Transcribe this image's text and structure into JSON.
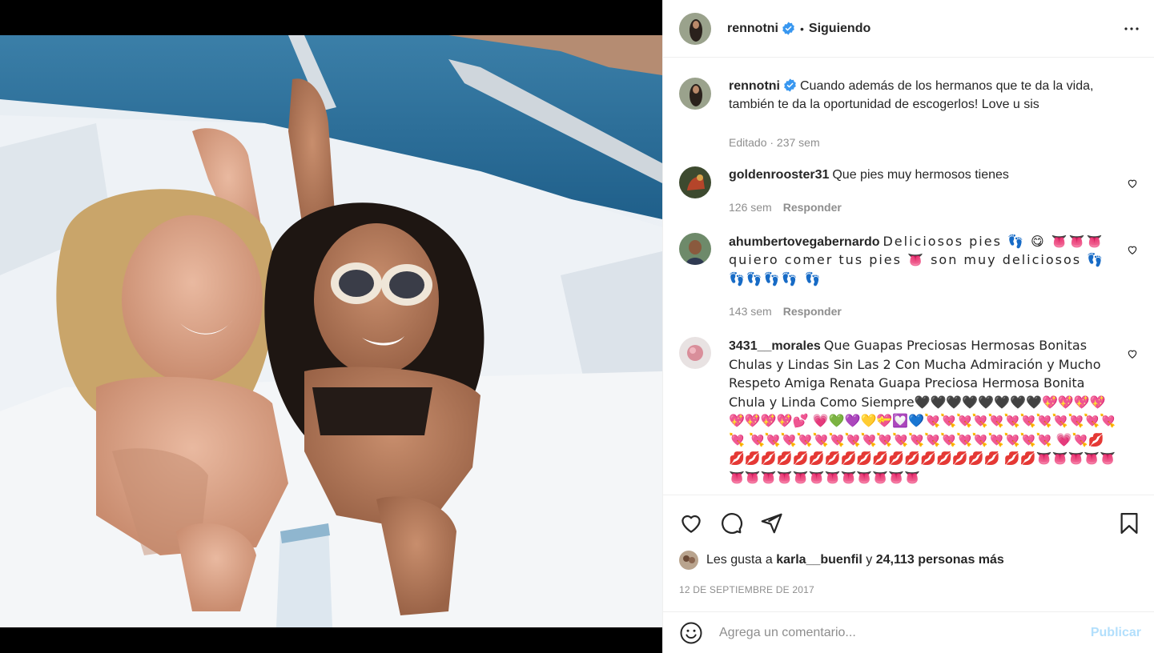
{
  "header": {
    "username": "rennotni",
    "separator": "•",
    "follow_status": "Siguiendo"
  },
  "caption": {
    "username": "rennotni",
    "text": "Cuando además de los hermanos que te da la vida, también te da la oportunidad de escogerlos! Love u sis",
    "meta": "Editado · 237 sem"
  },
  "comments": [
    {
      "username": "goldenrooster31",
      "text": "Que pies muy hermosos tienes",
      "time": "126 sem",
      "reply": "Responder"
    },
    {
      "username": "ahumbertovegabernardo",
      "text": "Deliciosos pies 👣 😋 👅👅👅 quiero comer tus pies 👅 son muy deliciosos 👣👣👣👣👣 👣",
      "time": "143 sem",
      "reply": "Responder"
    },
    {
      "username": "3431__morales",
      "text": "Que Guapas Preciosas Hermosas Bonitas Chulas y Lindas Sin Las 2 Con Mucha Admiración y Mucho Respeto Amiga Renata Guapa Preciosa Hermosa Bonita Chula y Linda Como Siempre🖤🖤🖤🖤🖤🖤🖤🖤💖💖💖💖💖💖💖💖💕 💗💚💜💛💝💟💙💘💘💘💘💘💘💘💘💘💘💘💘💘 💘💘💘💘💘💘💘💘💘💘💘💘💘💘💘💘💘💘💘 💗💘💋💋💋💋💋💋💋💋💋💋💋💋💋💋💋💋💋💋 💋💋👅👅👅👅👅👅👅👅👅👅👅👅👅👅👅👅👅"
    }
  ],
  "likes": {
    "prefix": "Les gusta a",
    "user": "karla__buenfil",
    "conj": "y",
    "rest": "24,113 personas más"
  },
  "date": "12 DE SEPTIEMBRE DE 2017",
  "add_comment": {
    "placeholder": "Agrega un comentario...",
    "publish": "Publicar"
  },
  "colors": {
    "verified": "#3897f0",
    "text": "#262626",
    "muted": "#8e8e8e",
    "publish_disabled": "#b2dffc",
    "border": "#efefef"
  },
  "icons": {
    "more": "more-horizontal-icon",
    "like": "heart-icon",
    "comment": "comment-bubble-icon",
    "share": "paper-plane-icon",
    "save": "bookmark-icon",
    "emoji": "smiley-icon",
    "verified": "verified-badge-icon"
  }
}
